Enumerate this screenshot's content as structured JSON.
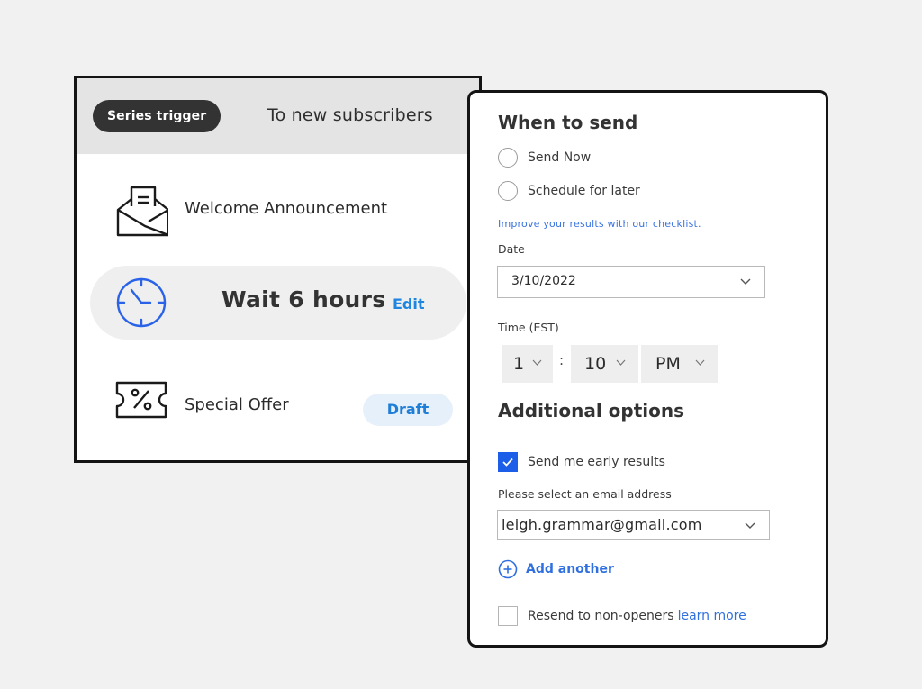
{
  "series": {
    "trigger_badge": "Series trigger",
    "trigger_target": "To new subscribers",
    "steps": [
      {
        "icon": "envelope-open-icon",
        "label": "Welcome Announcement"
      },
      {
        "icon": "clock-icon",
        "label": "Wait 6 hours",
        "action": "Edit"
      },
      {
        "icon": "coupon-percent-icon",
        "label": "Special Offer",
        "status": "Draft"
      }
    ]
  },
  "schedule": {
    "when_title": "When to send",
    "options": [
      {
        "label": "Send Now",
        "selected": false
      },
      {
        "label": "Schedule for later",
        "selected": false
      }
    ],
    "checklist_link": "Improve your results with our checklist.",
    "date_label": "Date",
    "date_value": "3/10/2022",
    "time_label": "Time (EST)",
    "time": {
      "hour": "1",
      "separator": ":",
      "minute": "10",
      "period": "PM"
    },
    "additional_title": "Additional options",
    "early_results": {
      "label": "Send me early results",
      "checked": true
    },
    "email_label": "Please select an email address",
    "email_value": "leigh.grammar@gmail.com",
    "add_another": "Add another",
    "resend": {
      "label": "Resend to non-openers",
      "link": "learn more",
      "checked": false
    }
  },
  "colors": {
    "accent_blue": "#1d5ee8",
    "link_blue": "#2f6fe0",
    "edit_blue": "#1f86e0",
    "draft_bg": "#e6f0fb",
    "page_bg": "#f1f1f1"
  }
}
